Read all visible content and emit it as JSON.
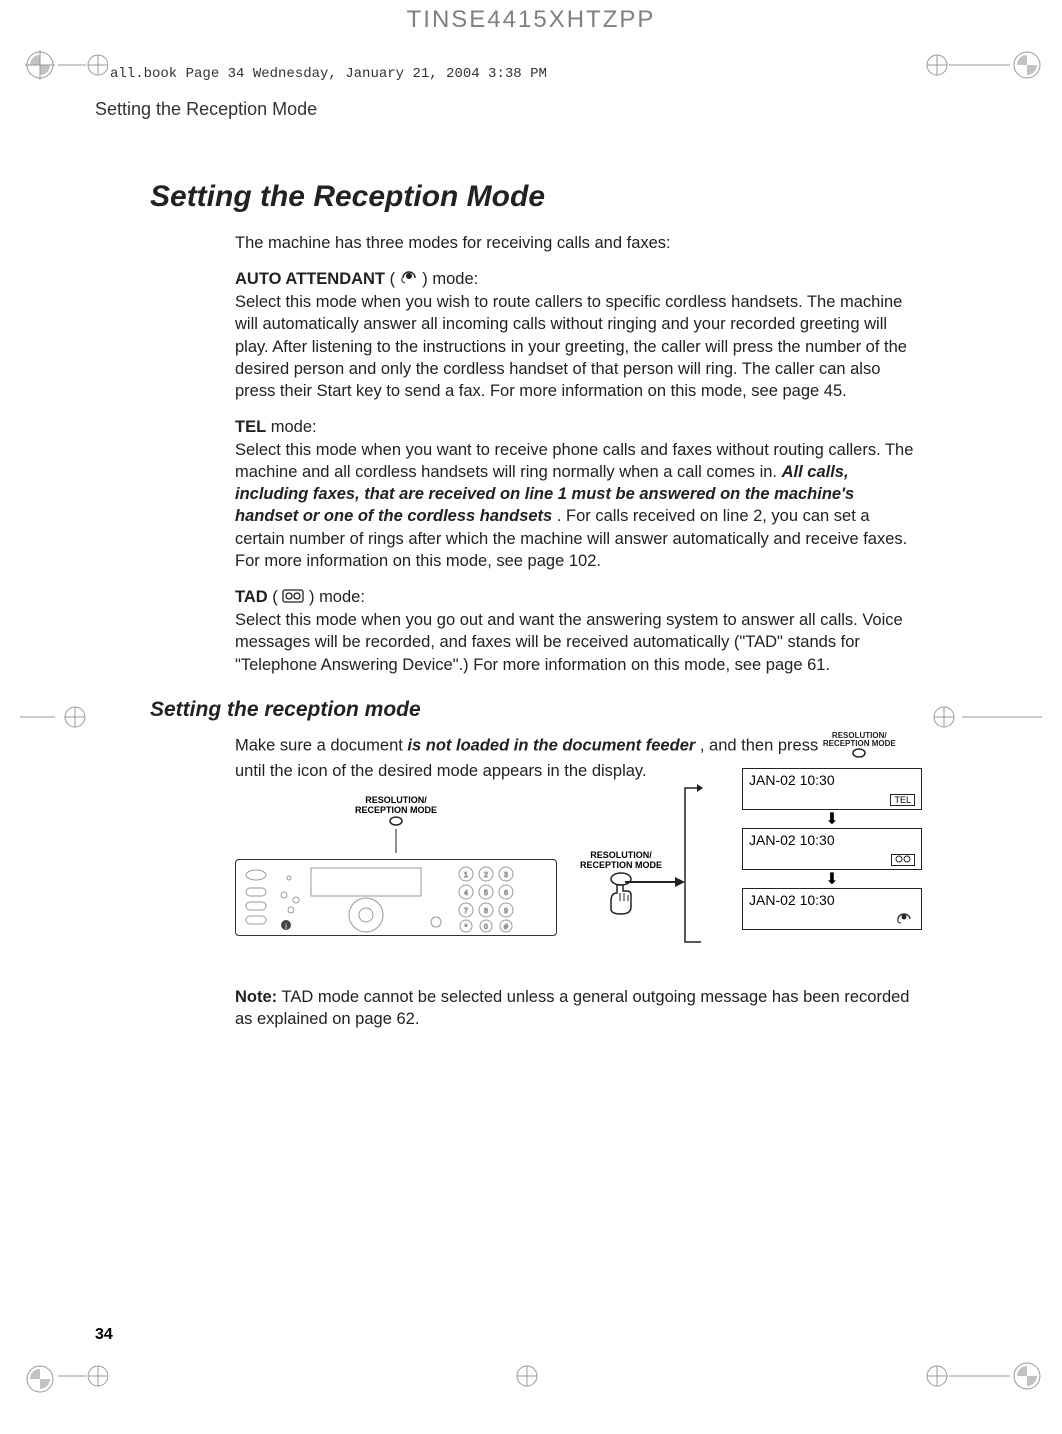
{
  "document": {
    "top_code": "TINSE4415XHTZPP",
    "book_ref": "all.book  Page 34  Wednesday, January 21, 2004  3:38 PM",
    "running_header": "Setting the Reception Mode",
    "page_number": "34"
  },
  "main": {
    "title": "Setting the Reception Mode",
    "intro": "The machine has three modes for receiving calls and faxes:",
    "modes": {
      "auto_attendant": {
        "label_prefix": "AUTO ATTENDANT",
        "label_suffix": " mode:",
        "icon_name": "operator-headset-icon",
        "text": "Select this mode when you wish to route callers to specific cordless handsets. The machine will automatically answer all incoming calls without ringing and your recorded greeting will play. After listening to the instructions in your greeting, the caller will press the number of the desired person and only the cordless handset of that person will ring. The caller can also press their Start key to send a fax. For more information on this mode, see page 45."
      },
      "tel": {
        "label_prefix": "TEL",
        "label_suffix": " mode:",
        "text_before_emph": "Select this mode when you want to receive phone calls and faxes without routing callers. The machine and all cordless handsets will ring normally when a call comes in. ",
        "emph": "All calls, including faxes, that are received on line 1 must be answered on the machine's handset or one of the cordless handsets",
        "text_after_emph": ". For calls received on line 2, you can set a certain number of rings after which the machine will answer automatically and receive faxes. For more information on this mode, see page 102."
      },
      "tad": {
        "label_prefix": "TAD",
        "label_suffix": "mode:",
        "icon_name": "tape-reel-icon",
        "text": "Select this mode when you go out and want the answering system to answer all calls. Voice messages will be recorded, and faxes will be received automatically (\"TAD\" stands for \"Telephone Answering Device\".) For more information on this mode, see page 61."
      }
    },
    "subtitle": "Setting the reception mode",
    "instruction": {
      "text_before": "Make sure a document ",
      "emph": "is not loaded in the document feeder",
      "text_mid": ", and then press ",
      "button_label": "RESOLUTION/\nRECEPTION MODE",
      "text_after": " until the icon of the desired mode appears in the display."
    },
    "figure": {
      "button_label_top": "RESOLUTION/",
      "button_label_bottom": "RECEPTION MODE",
      "displays": [
        {
          "time": "JAN-02 10:30",
          "icon_label": "TEL"
        },
        {
          "time": "JAN-02 10:30",
          "icon_label": "⊙⊙"
        },
        {
          "time": "JAN-02 10:30",
          "icon_label": "☺"
        }
      ]
    },
    "note": {
      "label": "Note:",
      "text": " TAD mode cannot be selected unless a general outgoing message has been recorded as explained on page 62."
    }
  }
}
